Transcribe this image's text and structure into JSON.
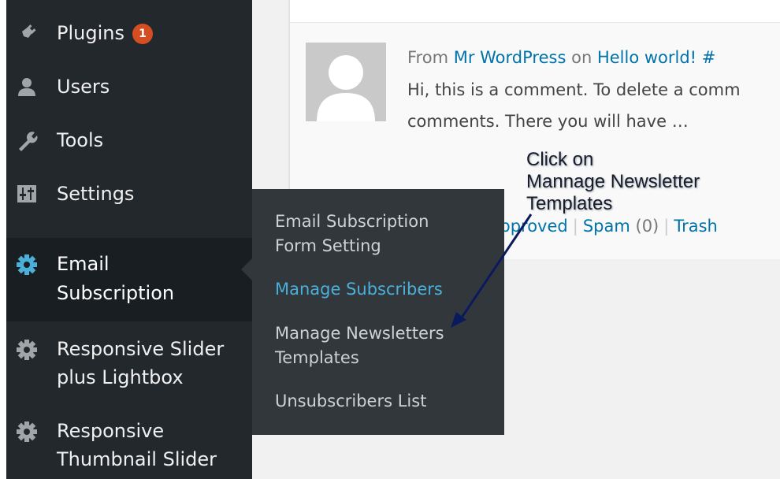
{
  "sidebar": {
    "items": [
      {
        "label": "Plugins",
        "icon": "plugins-icon",
        "badge": "1"
      },
      {
        "label": "Users",
        "icon": "users-icon"
      },
      {
        "label": "Tools",
        "icon": "tools-icon"
      },
      {
        "label": "Settings",
        "icon": "settings-icon"
      },
      {
        "label_line1": "Email",
        "label_line2": "Subscription",
        "icon": "gear-icon",
        "active": true
      },
      {
        "label_line1": "Responsive Slider",
        "label_line2": "plus Lightbox",
        "icon": "gear-icon"
      },
      {
        "label_line1": "Responsive",
        "label_line2": "Thumbnail Slider",
        "icon": "gear-icon"
      }
    ]
  },
  "submenu": {
    "items": [
      {
        "line1": "Email Subscription",
        "line2": "Form Setting"
      },
      {
        "line1": "Manage Subscribers",
        "current": true
      },
      {
        "line1": "Manage Newsletters",
        "line2": "Templates"
      },
      {
        "line1": "Unsubscribers List"
      }
    ]
  },
  "comment": {
    "from_prefix": "From",
    "author": "Mr WordPress",
    "on": "on",
    "post": "Hello world! #",
    "text_line1": "Hi, this is a comment. To delete a comm",
    "text_line2": "comments. There you will have …"
  },
  "filters": {
    "approved": "Approved",
    "spam": "Spam",
    "spam_count": "(0)",
    "trash": "Trash"
  },
  "annotation": {
    "line1": "Click on",
    "line2": "Mannage Newsletter",
    "line3": "Templates"
  },
  "colors": {
    "sidebar_bg": "#23282d",
    "flyout_bg": "#32373c",
    "accent": "#4ab0da",
    "badge": "#d54e21",
    "link": "#0073aa"
  }
}
